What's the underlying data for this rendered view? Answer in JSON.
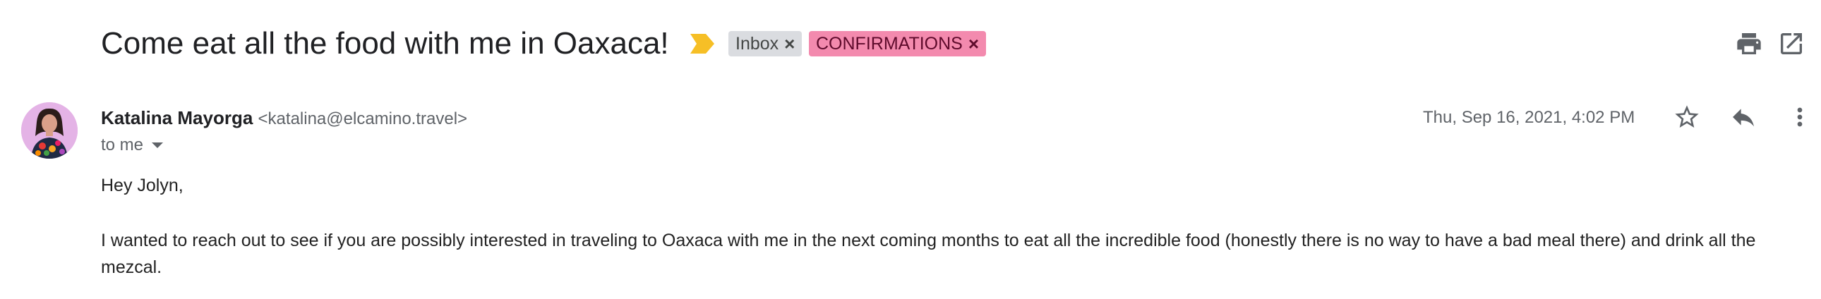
{
  "email": {
    "subject": "Come eat all the food with me in Oaxaca!",
    "labels": [
      {
        "text": "Inbox",
        "close": "×"
      },
      {
        "text": "CONFIRMATIONS",
        "close": "×"
      }
    ],
    "sender_name": "Katalina Mayorga",
    "sender_email": "<katalina@elcamino.travel>",
    "recipient": "to me",
    "date": "Thu, Sep 16, 2021, 4:02 PM",
    "greeting": "Hey Jolyn,",
    "body": "I wanted to reach out to see if you are possibly interested in traveling to Oaxaca with me in the next coming months to eat all the incredible food (honestly there is no way to have a bad meal there)  and drink all the mezcal."
  },
  "icons": {
    "importance": "importance-marker-icon",
    "print": "print-icon",
    "open_new_window": "open-in-new-window-icon",
    "star": "star-icon",
    "reply": "reply-icon",
    "more": "more-vertical-icon"
  },
  "colors": {
    "importance": "#f6bf26",
    "inbox_label_bg": "#dadce0",
    "confirmations_label_bg": "#f38aae",
    "text_primary": "#202124",
    "text_secondary": "#5f6368"
  }
}
